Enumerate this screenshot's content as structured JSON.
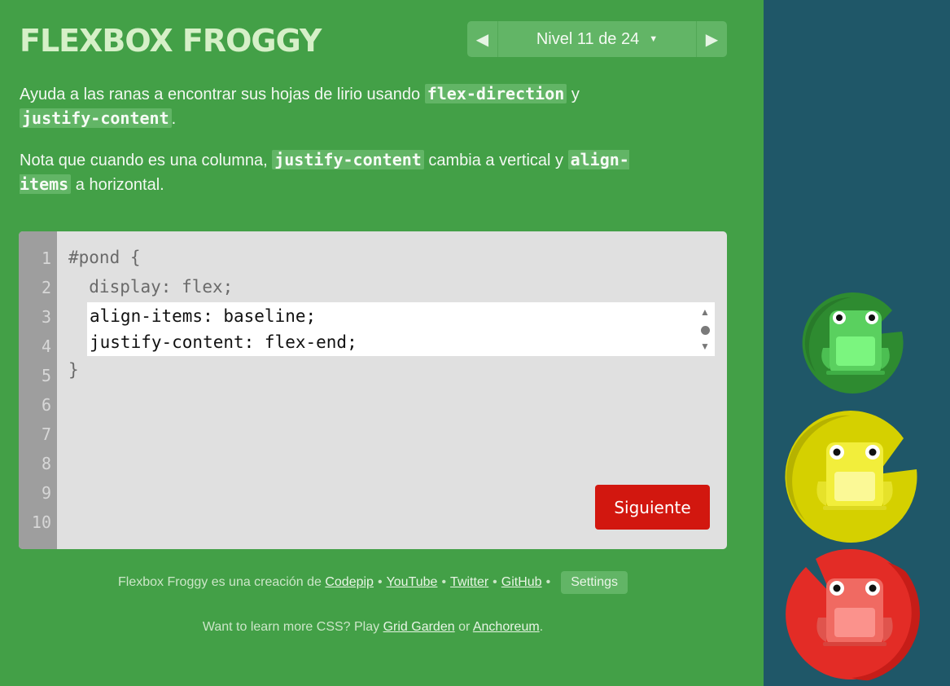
{
  "header": {
    "title": "FLEXBOX FROGGY",
    "level_indicator": "Nivel 11 de 24",
    "prev_icon": "triangle-left-icon",
    "next_icon": "triangle-right-icon",
    "dropdown_icon": "caret-down-icon"
  },
  "instructions": {
    "p1_prefix": "Ayuda a las ranas a encontrar sus hojas de lirio usando ",
    "p1_code1": "flex-direction",
    "p1_mid": " y ",
    "p1_code2": "justify-content",
    "p1_suffix": ".",
    "p2_prefix": "Nota que cuando es una columna, ",
    "p2_code1": "justify-content",
    "p2_mid": " cambia a vertical y ",
    "p2_code2": "align-items",
    "p2_suffix": " a horizontal."
  },
  "editor": {
    "line_numbers": [
      "1",
      "2",
      "3",
      "4",
      "5",
      "6",
      "7",
      "8",
      "9",
      "10"
    ],
    "line1": "#pond {",
    "line2": "  display: flex;",
    "input_value": "align-items: baseline;\njustify-content: flex-end;",
    "line5": "}",
    "next_button": "Siguiente"
  },
  "footer": {
    "credit_prefix": "Flexbox Froggy es una creación de ",
    "link_codepip": "Codepip",
    "link_youtube": "YouTube",
    "link_twitter": "Twitter",
    "link_github": "GitHub",
    "separator": "•",
    "settings": "Settings",
    "more_prefix": "Want to learn more CSS? Play ",
    "link_grid_garden": "Grid Garden",
    "more_or": " or ",
    "link_anchoreum": "Anchoreum",
    "more_suffix": "."
  },
  "colors": {
    "background_green": "#43a047",
    "pond_blue": "#1f5768",
    "next_button_red": "#d2170f",
    "lily_green": "#2e8b30",
    "lily_yellow": "#c9c500",
    "lily_red": "#e32c26",
    "frog_green": "#5ad05f",
    "frog_yellow": "#f2ee3b",
    "frog_red": "#f06a62"
  },
  "pond": {
    "frogs": [
      "green",
      "yellow",
      "red"
    ]
  }
}
